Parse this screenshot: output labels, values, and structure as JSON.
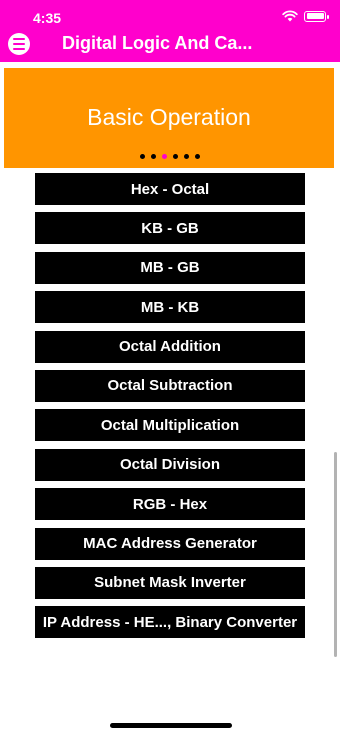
{
  "status_bar": {
    "time": "4:35"
  },
  "header": {
    "title": "Digital Logic And Ca...",
    "menu_icon": "menu-icon",
    "background": "#ff00cc"
  },
  "banner": {
    "text": "Basic Operation",
    "background": "#ff9500",
    "page_count": 6,
    "active_page": 2
  },
  "buttons": [
    {
      "label": "Hex - Octal"
    },
    {
      "label": "KB - GB"
    },
    {
      "label": "MB - GB"
    },
    {
      "label": "MB - KB"
    },
    {
      "label": "Octal Addition"
    },
    {
      "label": "Octal Subtraction"
    },
    {
      "label": "Octal Multiplication"
    },
    {
      "label": "Octal Division"
    },
    {
      "label": "RGB - Hex"
    },
    {
      "label": "MAC Address Generator"
    },
    {
      "label": "Subnet Mask Inverter"
    },
    {
      "label": "IP Address - HE..., Binary Converter"
    }
  ]
}
